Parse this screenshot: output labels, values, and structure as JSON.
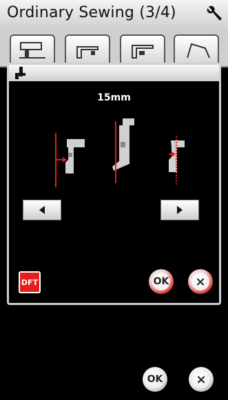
{
  "header": {
    "title": "Ordinary Sewing (3/4)",
    "settings_icon": "wrench-icon"
  },
  "tabs": [
    {
      "icon": "sewing-machine-tab-icon"
    },
    {
      "icon": "presser-foot-tab-icon"
    },
    {
      "icon": "needle-position-tab-icon"
    },
    {
      "icon": "thread-tension-tab-icon"
    }
  ],
  "dialog": {
    "icon": "needle-position-icon",
    "value": "15mm",
    "left_button_icon": "triangle-left-icon",
    "right_button_icon": "triangle-right-icon",
    "default_label": "DFT",
    "ok_label": "OK",
    "cancel_label": "×",
    "accent_color": "#e41d1d"
  },
  "footer": {
    "ok_label": "OK",
    "cancel_label": "×"
  }
}
